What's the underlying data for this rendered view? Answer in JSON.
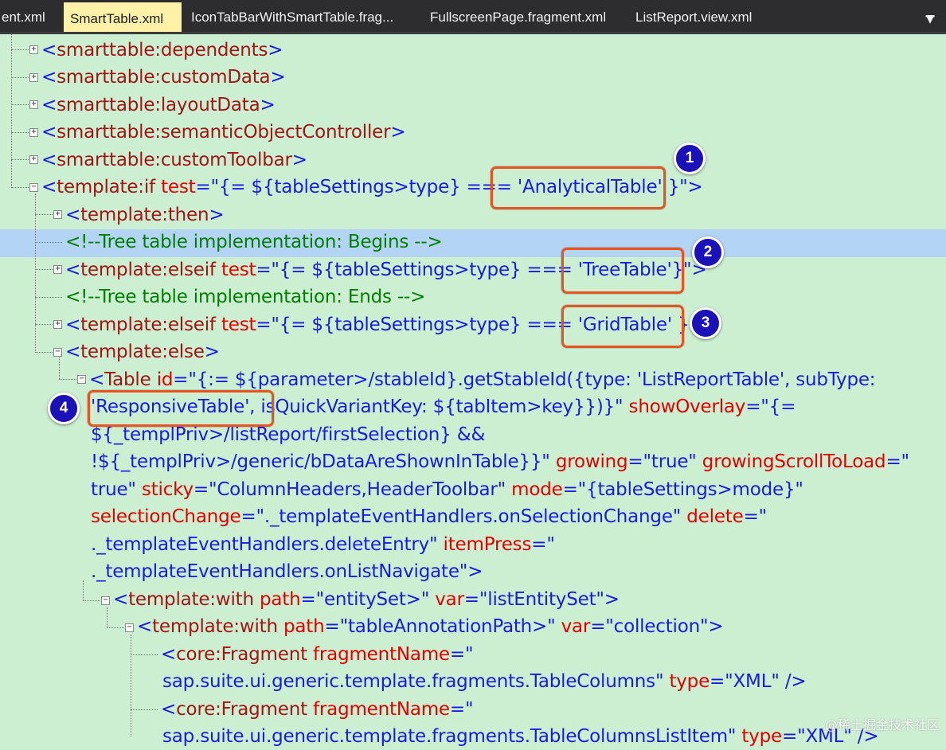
{
  "tabs": [
    {
      "label": "ent.xml",
      "active": false
    },
    {
      "label": "SmartTable.xml",
      "active": true
    },
    {
      "label": "IconTabBarWithSmartTable.frag...",
      "active": false
    },
    {
      "label": "FullscreenPage.fragment.xml",
      "active": false
    },
    {
      "label": "ListReport.view.xml",
      "active": false
    }
  ],
  "menu_icon": "dropdown-menu-icon",
  "code": {
    "l1": "smarttable:dependents",
    "l2": "smarttable:customData",
    "l3": "smarttable:layoutData",
    "l4": "smarttable:semanticObjectController",
    "l5": "smarttable:customToolbar",
    "l6_el": "template:if",
    "l6_attr": "test",
    "l6_val_a": "\"{= ${tableSettings>type} === ",
    "l6_val_b": "'AnalyticalTable'",
    "l6_val_c": " }\"",
    "l7": "template:then",
    "l8": "<!--Tree table implementation: Begins -->",
    "l9_el": "template:elseif",
    "l9_attr": "test",
    "l9_val_a": "\"{= ${tableSettings>type} === ",
    "l9_val_b": "'TreeTable'",
    "l9_val_c": "}\"",
    "l10": "<!--Tree table implementation: Ends -->",
    "l11_el": "template:elseif",
    "l11_attr": "test",
    "l11_val_a": "\"{= ${tableSettings>type} === ",
    "l11_val_b": "'GridTable'",
    "l11_val_c": " }\"",
    "l12": "template:else",
    "l13_el": "Table",
    "l13_attr": "id",
    "l13_val": "\"{:= ${parameter>/stableId}.getStableId({type: 'ListReportTable', subType:",
    "l14_val_a": "'ResponsiveTable',",
    "l14_val_b": " isQuickVariantKey: ${tabItem>key}})}\"",
    "l14_attr": "showOverlay",
    "l14_val_c": "\"{=",
    "l15": "${_templPriv>/listReport/firstSelection} &&",
    "l16_val": "!${_templPriv>/generic/bDataAreShownInTable}}\"",
    "l16_attr1": "growing",
    "l16_val1": "\"true\"",
    "l16_attr2": "growingScrollToLoad",
    "l16_val2": "\"",
    "l17_val0": "true\"",
    "l17_attr1": "sticky",
    "l17_val1": "\"ColumnHeaders,HeaderToolbar\"",
    "l17_attr2": "mode",
    "l17_val2": "\"{tableSettings>mode}\"",
    "l18_attr": "selectionChange",
    "l18_val": "\"._templateEventHandlers.onSelectionChange\"",
    "l18_attr2": "delete",
    "l18_val2": "\"",
    "l19_val": "._templateEventHandlers.deleteEntry\"",
    "l19_attr": "itemPress",
    "l19_val2": "\"",
    "l20_val": "._templateEventHandlers.onListNavigate\"",
    "l21_el": "template:with",
    "l21_attr1": "path",
    "l21_val1": "\"entitySet>\"",
    "l21_attr2": "var",
    "l21_val2": "\"listEntitySet\"",
    "l22_el": "template:with",
    "l22_attr1": "path",
    "l22_val1": "\"tableAnnotationPath>\"",
    "l22_attr2": "var",
    "l22_val2": "\"collection\"",
    "l23_el": "core:Fragment",
    "l23_attr": "fragmentName",
    "l23_val": "\"",
    "l24_val": "sap.suite.ui.generic.template.fragments.TableColumns\"",
    "l24_attr": "type",
    "l24_val2": "\"XML\"",
    "l25_el": "core:Fragment",
    "l25_attr": "fragmentName",
    "l25_val": "\"",
    "l26_val": "sap.suite.ui.generic.template.fragments.TableColumnsListItem\"",
    "l26_attr": "type",
    "l26_val2": "\"XML\""
  },
  "badges": [
    "1",
    "2",
    "3",
    "4"
  ],
  "watermark": "@稀土掘金技术社区",
  "colors": {
    "editor_bg": "#ccefd1",
    "highlight_line": "#b3d4f5",
    "callout_border": "#e8541f",
    "badge_fill": "#1a12b8",
    "element": "#a31515",
    "attribute": "#e50000",
    "value": "#1a1ae6",
    "comment": "#008000"
  }
}
